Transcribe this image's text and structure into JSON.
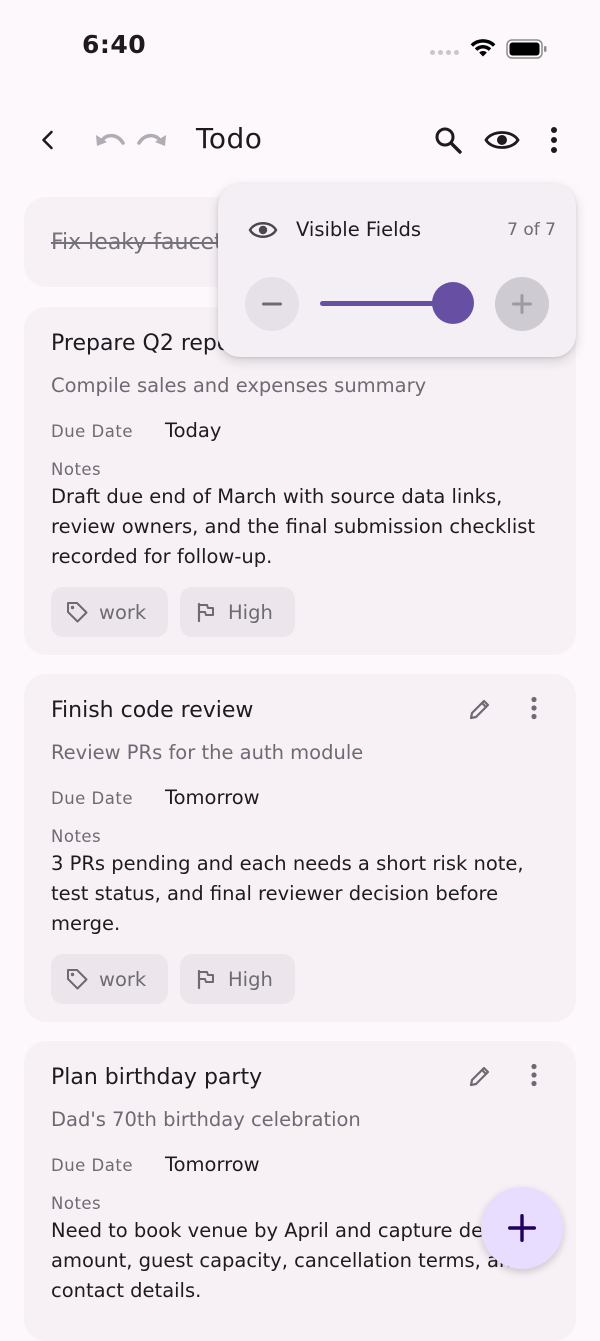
{
  "status_bar": {
    "time": "6:40"
  },
  "app_bar": {
    "title": "Todo",
    "icons": [
      "back-arrow-icon",
      "undo-icon",
      "redo-icon",
      "search-icon",
      "eye-icon",
      "more-vert-icon"
    ]
  },
  "popover": {
    "title": "Visible Fields",
    "count": "7 of 7",
    "slider_fraction": 1.0
  },
  "todos": [
    {
      "title": "Fix leaky faucet",
      "done": true
    },
    {
      "title": "Prepare Q2 report",
      "description": "Compile sales and expenses summary",
      "due_label": "Due Date",
      "due_value": "Today",
      "notes_label": "Notes",
      "notes": "Draft due end of March with source data links, review owners, and the final submission checklist recorded for follow-up.",
      "tag": "work",
      "priority": "High"
    },
    {
      "title": "Finish code review",
      "description": "Review PRs for the auth module",
      "due_label": "Due Date",
      "due_value": "Tomorrow",
      "notes_label": "Notes",
      "notes": "3 PRs pending and each needs a short risk note, test status, and final reviewer decision before merge.",
      "tag": "work",
      "priority": "High"
    },
    {
      "title": "Plan birthday party",
      "description": "Dad's 70th birthday celebration",
      "due_label": "Due Date",
      "due_value": "Tomorrow",
      "notes_label": "Notes",
      "notes": "Need to book venue by April and capture deposit amount, guest capacity, cancellation terms, and contact details."
    }
  ],
  "colors": {
    "accent": "#6750a4",
    "card_bg": "#f7f1f6",
    "chip_bg": "#ece6ec",
    "fab_bg": "#e8ddff"
  }
}
